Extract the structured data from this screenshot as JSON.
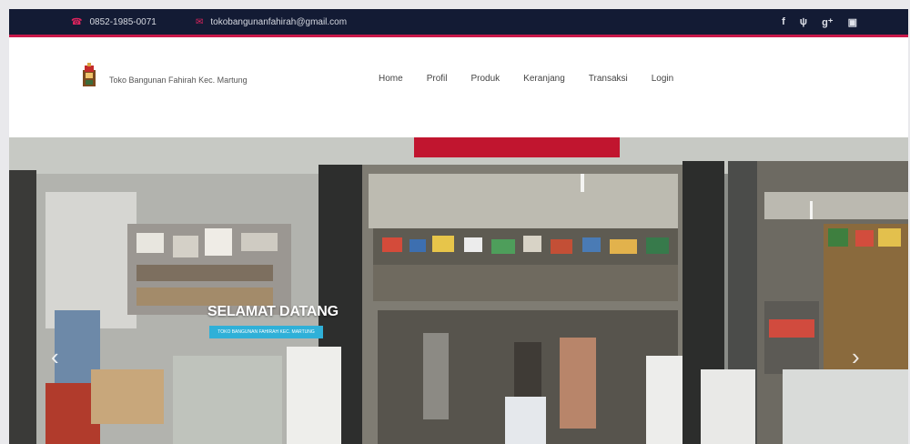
{
  "topbar": {
    "phone": "0852-1985-0071",
    "email": "tokobangunanfahirah@gmail.com",
    "social": [
      "f",
      "ψ",
      "g⁺",
      "▣"
    ]
  },
  "header": {
    "brand": "Toko Bangunan Fahirah Kec. Martung",
    "nav": [
      "Home",
      "Profil",
      "Produk",
      "Keranjang",
      "Transaksi",
      "Login"
    ]
  },
  "hero": {
    "title": "SELAMAT DATANG",
    "button": "TOKO BANGUNAN FAHIRAH KEC. MARTUNG",
    "prev": "‹",
    "next": "›"
  },
  "colors": {
    "topbar": "#131b34",
    "accent": "#c9184a",
    "button": "#2fb0d8"
  }
}
